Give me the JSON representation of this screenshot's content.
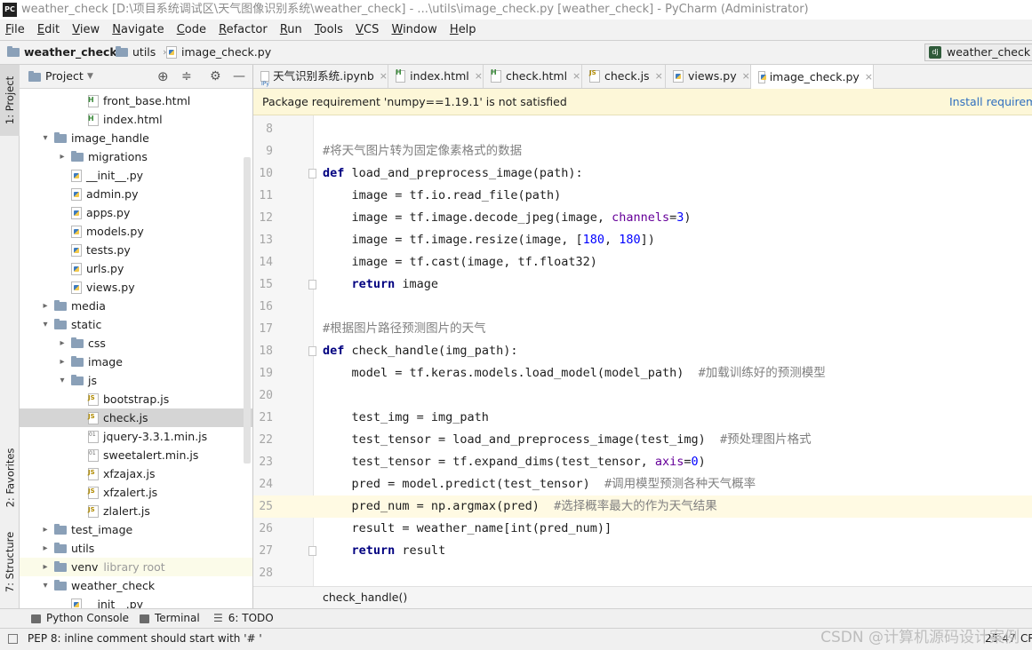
{
  "window": {
    "title": "weather_check [D:\\项目系统调试区\\天气图像识别系统\\weather_check] - ...\\utils\\image_check.py [weather_check] - PyCharm (Administrator)",
    "app_logo": "PC"
  },
  "menu": [
    "File",
    "Edit",
    "View",
    "Navigate",
    "Code",
    "Refactor",
    "Run",
    "Tools",
    "VCS",
    "Window",
    "Help"
  ],
  "navbar": {
    "project": "weather_check",
    "folder": "utils",
    "file": "image_check.py",
    "run_config": "weather_check",
    "run_config_icon": "dj"
  },
  "tool_stripe": {
    "project": "1: Project",
    "favorites": "2: Favorites",
    "structure": "7: Structure"
  },
  "project_panel": {
    "title": "Project",
    "tree": [
      {
        "label": "front_base.html",
        "icon": "html",
        "depth": 3
      },
      {
        "label": "index.html",
        "icon": "html",
        "depth": 3
      },
      {
        "label": "image_handle",
        "icon": "folder",
        "depth": 1,
        "arrow": "down"
      },
      {
        "label": "migrations",
        "icon": "folder",
        "depth": 2,
        "arrow": "right"
      },
      {
        "label": "__init__.py",
        "icon": "py",
        "depth": 2
      },
      {
        "label": "admin.py",
        "icon": "py",
        "depth": 2
      },
      {
        "label": "apps.py",
        "icon": "py",
        "depth": 2
      },
      {
        "label": "models.py",
        "icon": "py",
        "depth": 2
      },
      {
        "label": "tests.py",
        "icon": "py",
        "depth": 2
      },
      {
        "label": "urls.py",
        "icon": "py",
        "depth": 2
      },
      {
        "label": "views.py",
        "icon": "py",
        "depth": 2
      },
      {
        "label": "media",
        "icon": "folder",
        "depth": 1,
        "arrow": "right"
      },
      {
        "label": "static",
        "icon": "folder",
        "depth": 1,
        "arrow": "down"
      },
      {
        "label": "css",
        "icon": "folder",
        "depth": 2,
        "arrow": "right"
      },
      {
        "label": "image",
        "icon": "folder",
        "depth": 2,
        "arrow": "right"
      },
      {
        "label": "js",
        "icon": "folder",
        "depth": 2,
        "arrow": "down"
      },
      {
        "label": "bootstrap.js",
        "icon": "js",
        "depth": 3
      },
      {
        "label": "check.js",
        "icon": "js",
        "depth": 3,
        "selected": true
      },
      {
        "label": "jquery-3.3.1.min.js",
        "icon": "minjs",
        "depth": 3
      },
      {
        "label": "sweetalert.min.js",
        "icon": "minjs",
        "depth": 3
      },
      {
        "label": "xfzajax.js",
        "icon": "js",
        "depth": 3
      },
      {
        "label": "xfzalert.js",
        "icon": "js",
        "depth": 3
      },
      {
        "label": "zlalert.js",
        "icon": "js",
        "depth": 3
      },
      {
        "label": "test_image",
        "icon": "folder",
        "depth": 1,
        "arrow": "right"
      },
      {
        "label": "utils",
        "icon": "folder",
        "depth": 1,
        "arrow": "right"
      },
      {
        "label": "venv",
        "icon": "folder",
        "depth": 1,
        "arrow": "right",
        "suffix": "library root",
        "venv": true
      },
      {
        "label": "weather_check",
        "icon": "folder",
        "depth": 1,
        "arrow": "down"
      },
      {
        "label": "__init__.py",
        "icon": "py",
        "depth": 2
      }
    ]
  },
  "tabs": [
    {
      "label": "天气识别系统.ipynb",
      "icon": "ipynb"
    },
    {
      "label": "index.html",
      "icon": "html"
    },
    {
      "label": "check.html",
      "icon": "html"
    },
    {
      "label": "check.js",
      "icon": "js"
    },
    {
      "label": "views.py",
      "icon": "py"
    },
    {
      "label": "image_check.py",
      "icon": "py",
      "active": true
    }
  ],
  "notification": {
    "message": "Package requirement 'numpy==1.19.1' is not satisfied",
    "action": "Install requirement"
  },
  "code": {
    "current_line": 25,
    "lines": [
      {
        "n": "8",
        "html": ""
      },
      {
        "n": "9",
        "html": "<span class=\"cm\">#将天气图片转为固定像素格式的数据</span>"
      },
      {
        "n": "10",
        "html": "<span class=\"kw\">def</span> load_and_preprocess_image(path):",
        "fold": true
      },
      {
        "n": "11",
        "html": "    image = tf.io.read_file(path)"
      },
      {
        "n": "12",
        "html": "    image = tf.image.decode_jpeg(image, <span class=\"pm\">channels</span>=<span class=\"nm\">3</span>)"
      },
      {
        "n": "13",
        "html": "    image = tf.image.resize(image, [<span class=\"nm\">180</span>, <span class=\"nm\">180</span>])"
      },
      {
        "n": "14",
        "html": "    image = tf.cast(image, tf.float32)"
      },
      {
        "n": "15",
        "html": "    <span class=\"kw\">return</span> image",
        "fold": true
      },
      {
        "n": "16",
        "html": ""
      },
      {
        "n": "17",
        "html": "<span class=\"cm\">#根据图片路径预测图片的天气</span>"
      },
      {
        "n": "18",
        "html": "<span class=\"kw\">def</span> check_handle(img_path):",
        "fold": true
      },
      {
        "n": "19",
        "html": "    model = tf.keras.models.load_model(model_path)  <span class=\"cm\">#加载训练好的预测模型</span>"
      },
      {
        "n": "20",
        "html": ""
      },
      {
        "n": "21",
        "html": "    test_img = img_path"
      },
      {
        "n": "22",
        "html": "    test_tensor = load_and_preprocess_image(test_img)  <span class=\"cm\">#预处理图片格式</span>"
      },
      {
        "n": "23",
        "html": "    test_tensor = tf.expand_dims(test_tensor, <span class=\"pm\">axis</span>=<span class=\"nm\">0</span>)"
      },
      {
        "n": "24",
        "html": "    pred = model.predict(test_tensor)  <span class=\"cm\">#调用模型预测各种天气概率</span>"
      },
      {
        "n": "25",
        "html": "    pred_num = np.argmax(pred)  <span class=\"cm\">#选择概率最大的作为天气结果</span>"
      },
      {
        "n": "26",
        "html": "    result = weather_name[int(pred_num)]"
      },
      {
        "n": "27",
        "html": "    <span class=\"kw\">return</span> result",
        "fold": true
      },
      {
        "n": "28",
        "html": ""
      }
    ]
  },
  "editor_breadcrumb": "check_handle()",
  "bottom_tools": [
    {
      "label": "Python Console"
    },
    {
      "label": "Terminal"
    },
    {
      "label": "6: TODO"
    }
  ],
  "status": {
    "message": "PEP 8: inline comment should start with '# '",
    "position": "25:47",
    "encoding": "CRLF"
  },
  "watermark": "CSDN @计算机源码设计案例"
}
